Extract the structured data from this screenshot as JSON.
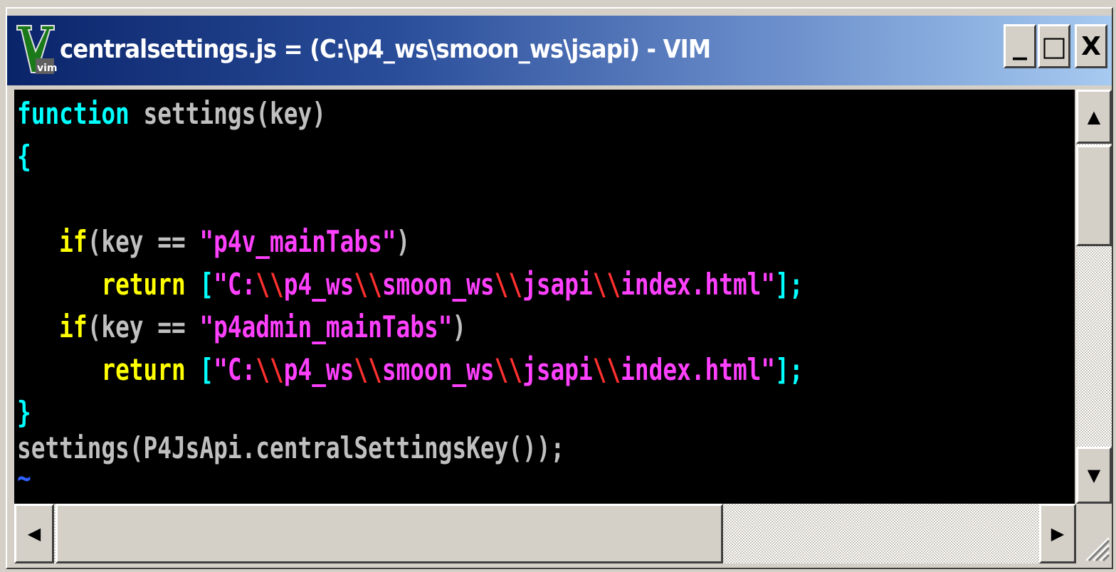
{
  "window": {
    "title": "centralsettings.js = (C:\\p4_ws\\smoon_ws\\jsapi) - VIM",
    "buttons": {
      "minimize": "_",
      "maximize": "□",
      "close": "X"
    }
  },
  "icons": {
    "app": "vim-icon",
    "scroll_up": "▲",
    "scroll_down": "▼",
    "scroll_left": "◀",
    "scroll_right": "▶"
  },
  "colors": {
    "keyword": "#00ffff",
    "identifier": "#c0c0c0",
    "statement": "#ffff00",
    "string": "#ff40ff",
    "escape": "#ff3030",
    "nontext": "#3060ff",
    "background": "#000000"
  },
  "code": {
    "l1": {
      "kw": "function",
      "rest": " settings(key)"
    },
    "l2": {
      "brace": "{"
    },
    "l4": {
      "indent": "   ",
      "kw": "if",
      "a": "(key == ",
      "str": "\"p4v_mainTabs\"",
      "b": ")"
    },
    "l5": {
      "indent": "      ",
      "kw": "return",
      "sp": " ",
      "open": "[",
      "s1": "\"C:",
      "e1": "\\\\",
      "s2": "p4_ws",
      "e2": "\\\\",
      "s3": "smoon_ws",
      "e3": "\\\\",
      "s4": "jsapi",
      "e4": "\\\\",
      "s5": "index.html\"",
      "close": "];"
    },
    "l6": {
      "indent": "   ",
      "kw": "if",
      "a": "(key == ",
      "str": "\"p4admin_mainTabs\"",
      "b": ")"
    },
    "l7": {
      "indent": "      ",
      "kw": "return",
      "sp": " ",
      "open": "[",
      "s1": "\"C:",
      "e1": "\\\\",
      "s2": "p4_ws",
      "e2": "\\\\",
      "s3": "smoon_ws",
      "e3": "\\\\",
      "s4": "jsapi",
      "e4": "\\\\",
      "s5": "index.html\"",
      "close": "];"
    },
    "l8": {
      "brace": "}"
    },
    "l9": {
      "text": "settings(P4JsApi.centralSettingsKey());"
    },
    "l10": {
      "tilde": "~"
    }
  }
}
